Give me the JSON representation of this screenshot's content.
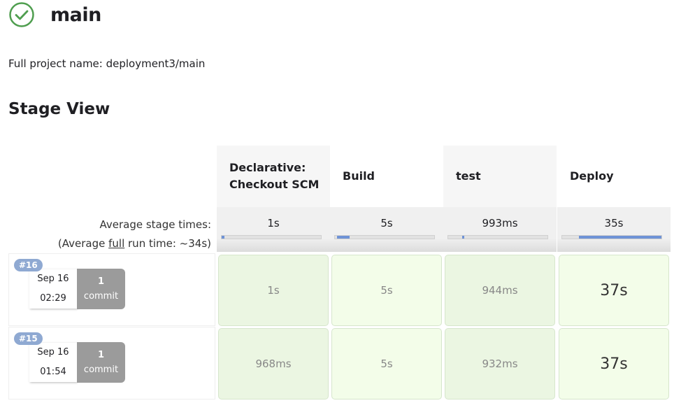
{
  "header": {
    "title": "main",
    "status_icon": "success-check-circle",
    "full_name_label": "Full project name: deployment3/main"
  },
  "stage_view": {
    "title": "Stage View",
    "avg_label": "Average stage times:",
    "avg_full_prefix": "(Average ",
    "avg_full_link": "full",
    "avg_full_suffix": " run time: ~34s)",
    "stages": [
      {
        "name": "Declarative: Checkout SCM",
        "avg": "1s",
        "bar_start_pct": 0,
        "bar_fill_pct": 3
      },
      {
        "name": "Build",
        "avg": "5s",
        "bar_start_pct": 2,
        "bar_fill_pct": 13
      },
      {
        "name": "test",
        "avg": "993ms",
        "bar_start_pct": 14,
        "bar_fill_pct": 2
      },
      {
        "name": "Deploy",
        "avg": "35s",
        "bar_start_pct": 17,
        "bar_fill_pct": 83
      }
    ],
    "builds": [
      {
        "number": "#16",
        "date": "Sep 16",
        "time": "02:29",
        "commits": "1",
        "commit_label": "commit",
        "times": [
          "1s",
          "5s",
          "944ms",
          "37s"
        ]
      },
      {
        "number": "#15",
        "date": "Sep 16",
        "time": "01:54",
        "commits": "1",
        "commit_label": "commit",
        "times": [
          "968ms",
          "5s",
          "932ms",
          "37s"
        ]
      }
    ]
  },
  "colors": {
    "success": "#4f9e4f",
    "cell_dark": "#ebf6e2",
    "cell_light": "#f3fde9",
    "bar": "#6f93d6",
    "badge": "#8fa9d2"
  }
}
